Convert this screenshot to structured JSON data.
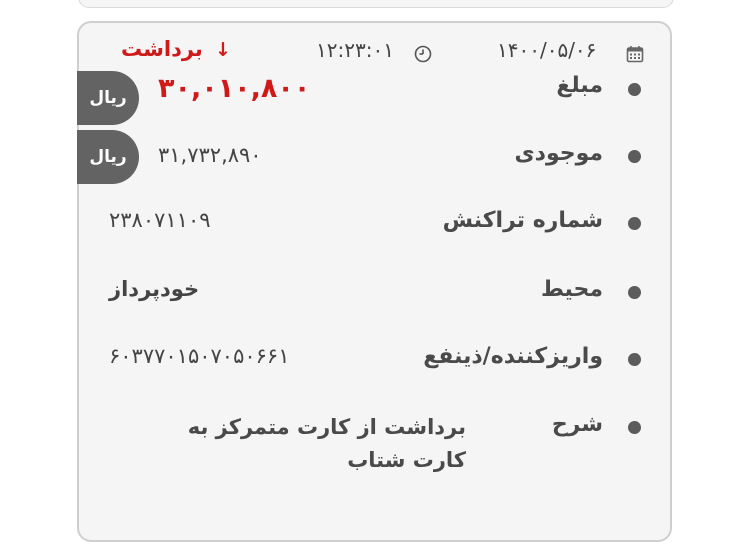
{
  "header": {
    "date": "۱۴۰۰/۰۵/۰۶",
    "time": "۱۲:۲۳:۰۱",
    "type_label": "برداشت",
    "type_arrow": "↓",
    "calendar_icon": "calendar-icon",
    "clock_icon": "clock-icon"
  },
  "rows": {
    "amount": {
      "label": "مبلغ",
      "value": "۳۰,۰۱۰,۸۰۰",
      "currency": "ریال"
    },
    "balance": {
      "label": "موجودی",
      "value": "۳۱,۷۳۲,۸۹۰",
      "currency": "ریال"
    },
    "transaction_number": {
      "label": "شماره تراکنش",
      "value": "۲۳۸۰۷۱۱۰۹"
    },
    "environment": {
      "label": "محیط",
      "value": "خودپرداز"
    },
    "payer": {
      "label": "واریزکننده/ذینفع",
      "value": "۶۰۳۷۷۰۱۵۰۷۰۵۰۶۶۱"
    },
    "description": {
      "label": "شرح",
      "value": "برداشت از کارت متمرکز به کارت شتاب"
    }
  },
  "colors": {
    "withdraw": "#d01a1a",
    "pill": "#636363",
    "card_bg": "#f5f5f5"
  }
}
